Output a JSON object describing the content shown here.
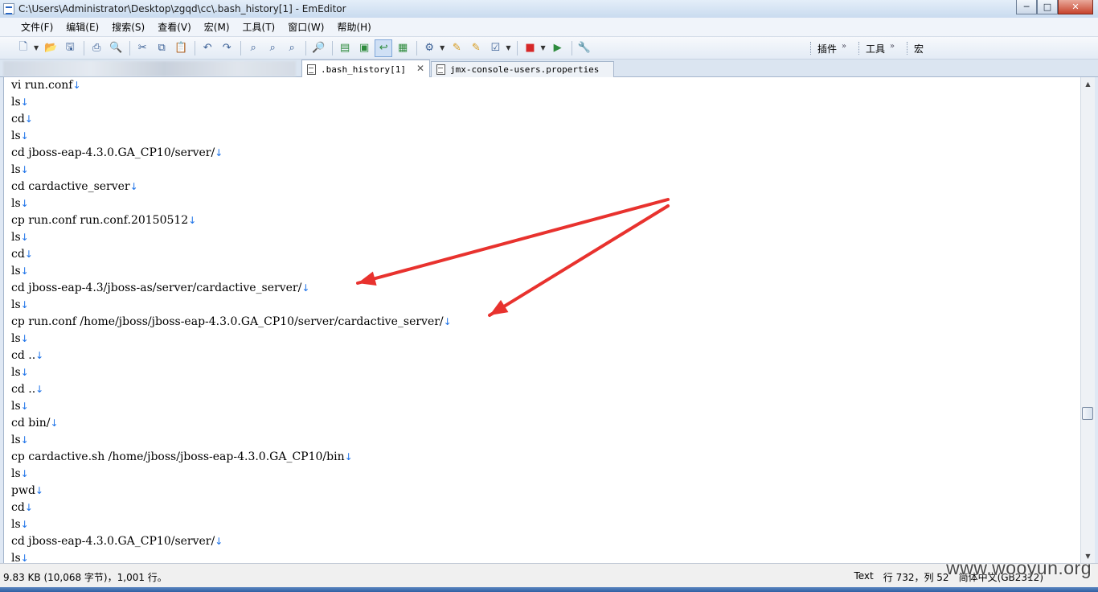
{
  "window": {
    "title": "C:\\Users\\Administrator\\Desktop\\zgqd\\cc\\.bash_history[1] - EmEditor",
    "minimize_glyph": "─",
    "maximize_glyph": "□",
    "close_glyph": "✕"
  },
  "menu": {
    "items": [
      "文件(F)",
      "编辑(E)",
      "搜索(S)",
      "查看(V)",
      "宏(M)",
      "工具(T)",
      "窗口(W)",
      "帮助(H)"
    ]
  },
  "toolbar": {
    "icons": [
      "new-icon",
      "open-icon",
      "save-icon",
      "print-icon",
      "print-preview-icon",
      "cut-icon",
      "copy-icon",
      "paste-icon",
      "undo-icon",
      "redo-icon",
      "find-icon",
      "find-next-icon",
      "find-previous-icon",
      "find-in-files-icon",
      "toggle-icon",
      "toggle-icon",
      "wrap-icon",
      "view-icon",
      "macro-icon",
      "properties-icon",
      "config-icon",
      "check-icon",
      "stop-record-icon",
      "run-macro-icon",
      "tools-icon"
    ],
    "plugins_label": "插件",
    "tools_label": "工具",
    "macros_label": "宏",
    "more_glyph": "»"
  },
  "tabs": [
    {
      "label": ".bash_history[1]",
      "active": true,
      "close": "✕"
    },
    {
      "label": "jmx-console-users.properties",
      "active": false
    }
  ],
  "editor": {
    "newline_mark": "↓",
    "lines": [
      "vi run.conf",
      "ls",
      "cd",
      "ls",
      "cd jboss-eap-4.3.0.GA_CP10/server/",
      "ls",
      "cd cardactive_server",
      "ls",
      "cp run.conf run.conf.20150512",
      "ls",
      "cd",
      "ls",
      "cd jboss-eap-4.3/jboss-as/server/cardactive_server/",
      "ls",
      "cp run.conf /home/jboss/jboss-eap-4.3.0.GA_CP10/server/cardactive_server/",
      "ls",
      "cd ..",
      "ls",
      "cd ..",
      "ls",
      "cd bin/",
      "ls",
      "cp cardactive.sh /home/jboss/jboss-eap-4.3.0.GA_CP10/bin",
      "ls",
      "pwd",
      "cd",
      "ls",
      "cd jboss-eap-4.3.0.GA_CP10/server/",
      "ls"
    ],
    "annotation_color": "#e8322e"
  },
  "scrollbar": {
    "up": "▲",
    "down": "▼",
    "position": 0.71
  },
  "status": {
    "file_info": "9.83 KB (10,068 字节)，1,001 行。",
    "mode": "Text",
    "position": "行 732，列 52",
    "encoding": "简体中文(GB2312)"
  },
  "watermark": "www.wooyun.org"
}
